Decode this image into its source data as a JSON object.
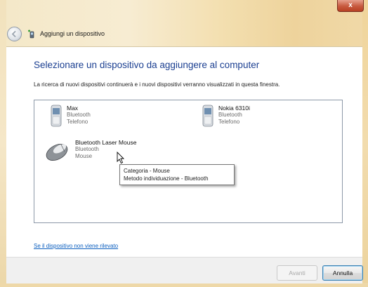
{
  "window": {
    "title": "Aggiungi un dispositivo",
    "close_label": "x"
  },
  "page": {
    "heading": "Selezionare un dispositivo da aggiungere al computer",
    "description": "La ricerca di nuovi dispositivi continuerà e i nuovi dispositivi verranno visualizzati in questa finestra."
  },
  "devices": [
    {
      "name": "Max",
      "connection": "Bluetooth",
      "type": "Telefono",
      "icon": "phone-icon"
    },
    {
      "name": "Nokia 6310i",
      "connection": "Bluetooth",
      "type": "Telefono",
      "icon": "phone-icon"
    },
    {
      "name": "Bluetooth Laser Mouse",
      "connection": "Bluetooth",
      "type": "Mouse",
      "icon": "mouse-icon"
    }
  ],
  "tooltip": {
    "line1": "Categoria - Mouse",
    "line2": "Metodo individuazione - Bluetooth"
  },
  "help_link": "Se il dispositivo non viene rilevato",
  "buttons": {
    "next": "Avanti",
    "cancel": "Annulla"
  },
  "colors": {
    "heading": "#1b3f91",
    "link": "#0c5fbf",
    "frame": "#f4e8c8"
  }
}
